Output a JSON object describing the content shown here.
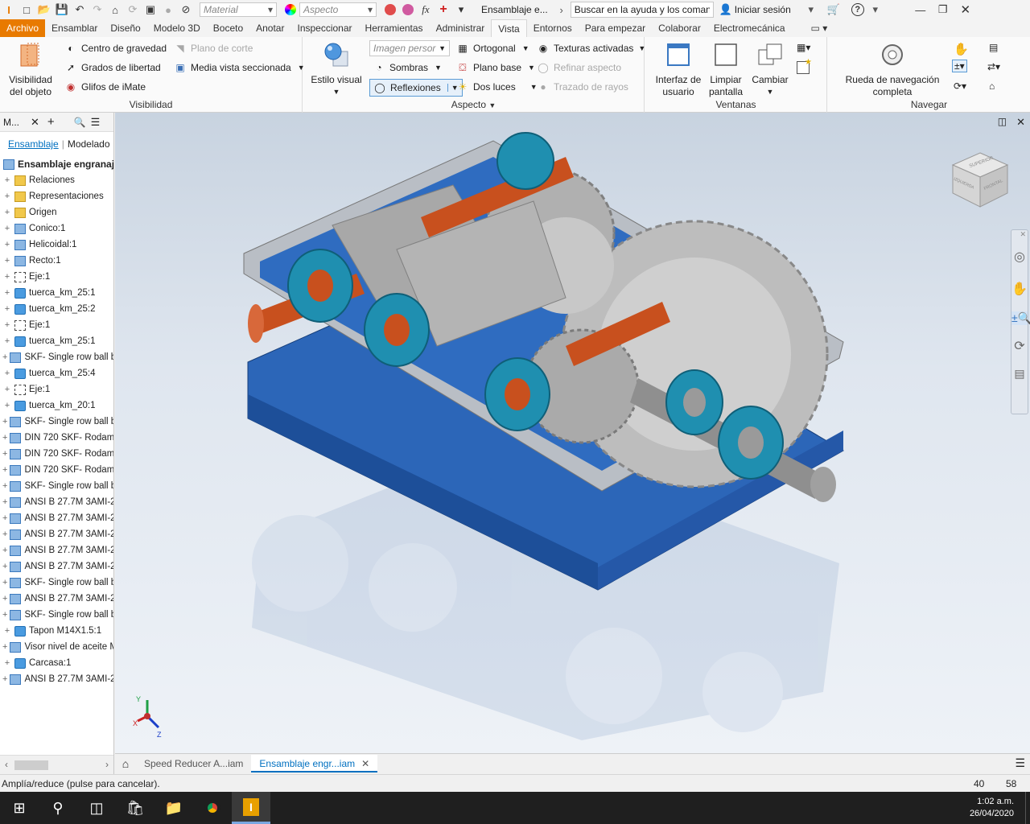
{
  "qat": {
    "material_placeholder": "Material",
    "aspect_placeholder": "Aspecto",
    "doc_title": "Ensamblaje e...",
    "search_placeholder": "Buscar en la ayuda y los comanc",
    "signin": "Iniciar sesión"
  },
  "tabs": [
    "Archivo",
    "Ensamblar",
    "Diseño",
    "Modelo 3D",
    "Boceto",
    "Anotar",
    "Inspeccionar",
    "Herramientas",
    "Administrar",
    "Vista",
    "Entornos",
    "Para empezar",
    "Colaborar",
    "Electromecánica"
  ],
  "active_tab": "Vista",
  "ribbon": {
    "visibility": {
      "label": "Visibilidad",
      "object_visibility": "Visibilidad del objeto",
      "center_gravity": "Centro de gravedad",
      "degrees_freedom": "Grados de libertad",
      "imate_glyphs": "Glifos de iMate",
      "cut_plane": "Plano de corte",
      "half_section": "Media vista seccionada"
    },
    "aspect": {
      "label": "Aspecto",
      "visual_style": "Estilo visual",
      "image_dropdown": "Imagen persor",
      "shadows": "Sombras",
      "reflections": "Reflexiones",
      "orthographic": "Ortogonal",
      "ground_plane": "Plano base",
      "two_lights": "Dos luces",
      "textures": "Texturas activadas",
      "refine_aspect": "Refinar aspecto",
      "ray_tracing": "Trazado de rayos"
    },
    "windows": {
      "label": "Ventanas",
      "user_interface": "Interfaz de usuario",
      "clean_screen": "Limpiar pantalla",
      "switch": "Cambiar"
    },
    "navigate": {
      "label": "Navegar",
      "full_wheel": "Rueda de navegación completa"
    }
  },
  "browser": {
    "title": "M...",
    "tab_assembly": "Ensamblaje",
    "tab_modeling": "Modelado",
    "root": "Ensamblaje engranaj",
    "items": [
      {
        "label": "Relaciones",
        "type": "folder"
      },
      {
        "label": "Representaciones",
        "type": "folder"
      },
      {
        "label": "Origen",
        "type": "folder"
      },
      {
        "label": "Conico:1",
        "type": "asm"
      },
      {
        "label": "Helicoidal:1",
        "type": "asm"
      },
      {
        "label": "Recto:1",
        "type": "asm"
      },
      {
        "label": "Eje:1",
        "type": "axis"
      },
      {
        "label": "tuerca_km_25:1",
        "type": "part"
      },
      {
        "label": "tuerca_km_25:2",
        "type": "part"
      },
      {
        "label": "Eje:1",
        "type": "axis"
      },
      {
        "label": "tuerca_km_25:1",
        "type": "part"
      },
      {
        "label": "SKF- Single row ball b",
        "type": "asm"
      },
      {
        "label": "tuerca_km_25:4",
        "type": "part"
      },
      {
        "label": "Eje:1",
        "type": "axis"
      },
      {
        "label": "tuerca_km_20:1",
        "type": "part"
      },
      {
        "label": "SKF- Single row ball b",
        "type": "asm"
      },
      {
        "label": "DIN 720 SKF- Rodami",
        "type": "asm"
      },
      {
        "label": "DIN 720 SKF- Rodami",
        "type": "asm"
      },
      {
        "label": "DIN 720 SKF- Rodami",
        "type": "asm"
      },
      {
        "label": "SKF- Single row ball b",
        "type": "asm"
      },
      {
        "label": "ANSI B 27.7M 3AMI-2",
        "type": "asm"
      },
      {
        "label": "ANSI B 27.7M 3AMI-2",
        "type": "asm"
      },
      {
        "label": "ANSI B 27.7M 3AMI-2",
        "type": "asm"
      },
      {
        "label": "ANSI B 27.7M 3AMI-2",
        "type": "asm"
      },
      {
        "label": "ANSI B 27.7M 3AMI-2",
        "type": "asm"
      },
      {
        "label": "SKF- Single row ball b",
        "type": "asm"
      },
      {
        "label": "ANSI B 27.7M 3AMI-2",
        "type": "asm"
      },
      {
        "label": "SKF- Single row ball b",
        "type": "asm"
      },
      {
        "label": "Tapon M14X1.5:1",
        "type": "part"
      },
      {
        "label": "Visor nivel de aceite M",
        "type": "asm"
      },
      {
        "label": "Carcasa:1",
        "type": "part"
      },
      {
        "label": "ANSI B 27.7M 3AMI-2",
        "type": "asm"
      }
    ]
  },
  "viewcube": {
    "top": "SUPERIOR",
    "left": "IZQUIERDA",
    "front": "FRONTAL"
  },
  "doc_tabs": [
    {
      "label": "Speed Reducer A...iam",
      "active": false
    },
    {
      "label": "Ensamblaje engr...iam",
      "active": true
    }
  ],
  "status": {
    "message": "Amplía/reduce (pulse para cancelar).",
    "val1": "40",
    "val2": "58"
  },
  "taskbar": {
    "time": "1:02 a.m.",
    "date": "26/04/2020"
  },
  "colors": {
    "file_tab": "#e87a00",
    "housing": "#2c66b8",
    "shaft": "#c8501e",
    "bearing": "#1f8fb0",
    "gear": "#a6a6a6"
  }
}
